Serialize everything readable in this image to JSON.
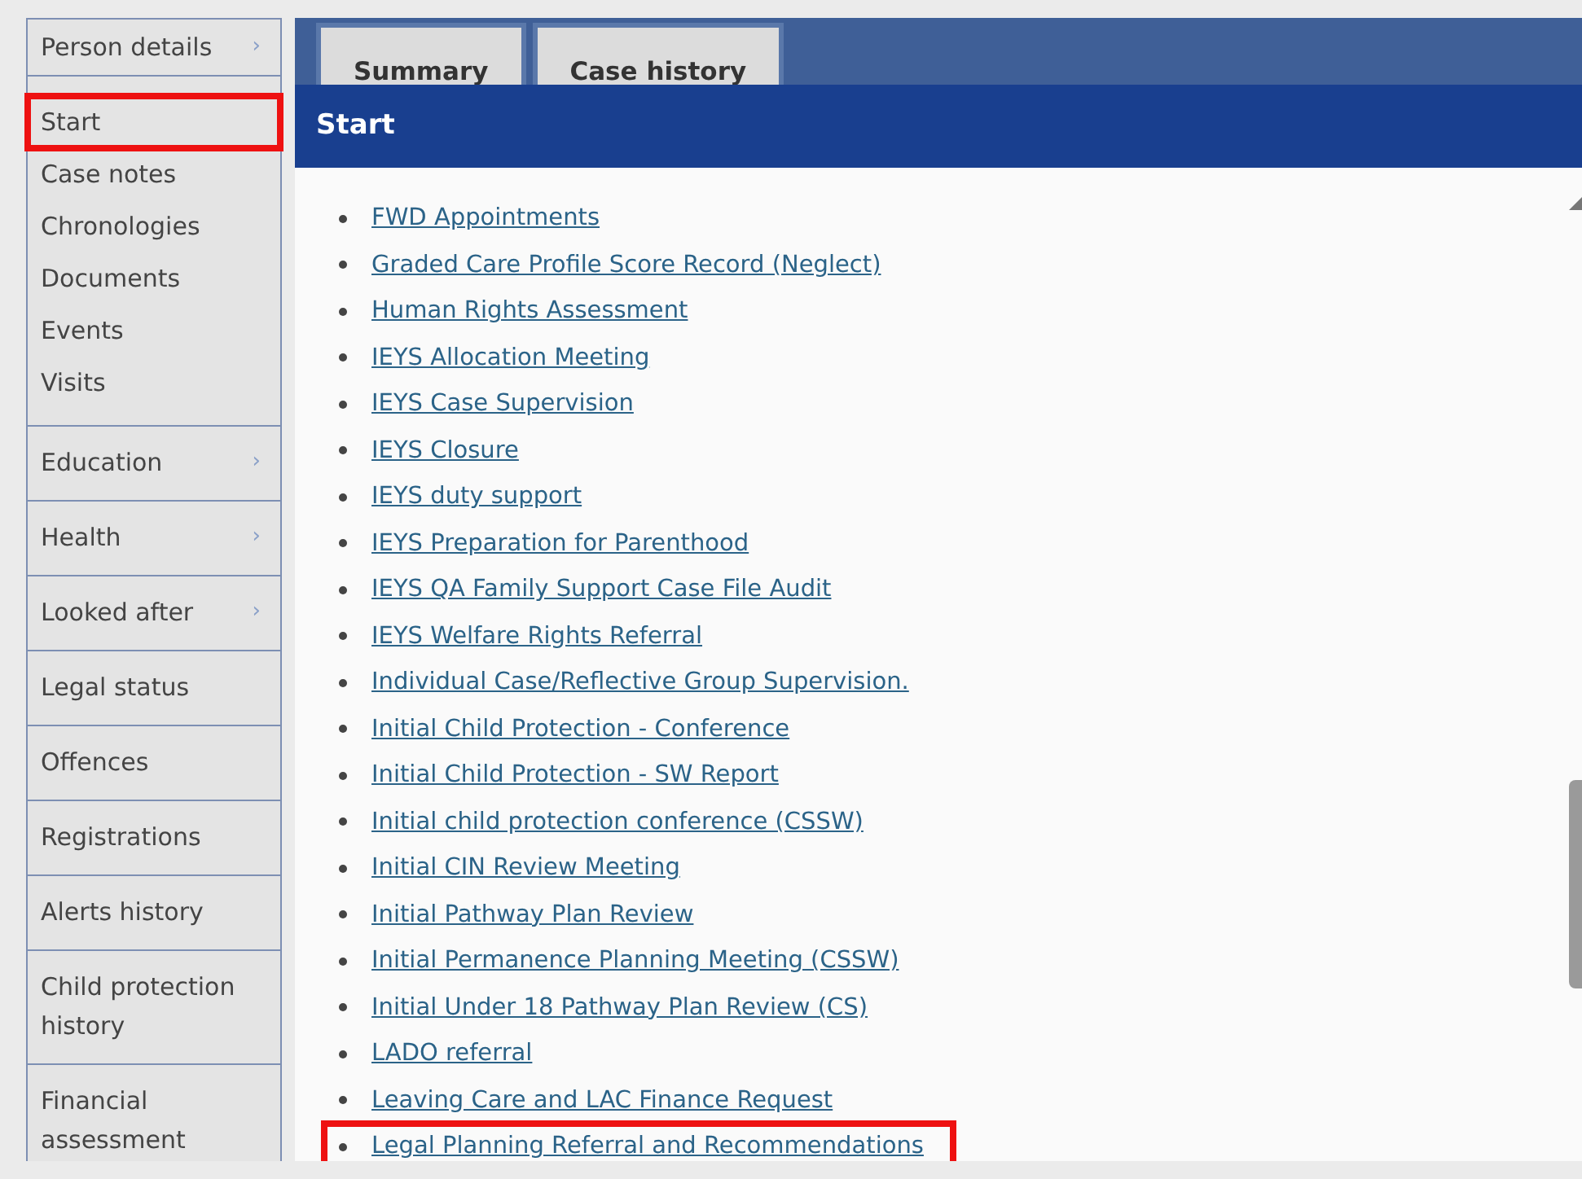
{
  "sidebar": {
    "header": {
      "label": "Person details",
      "chevron": "›"
    },
    "links": [
      {
        "label": "Start",
        "highlighted": true
      },
      {
        "label": "Case notes",
        "highlighted": false
      },
      {
        "label": "Chronologies",
        "highlighted": false
      },
      {
        "label": "Documents",
        "highlighted": false
      },
      {
        "label": "Events",
        "highlighted": false
      },
      {
        "label": "Visits",
        "highlighted": false
      }
    ],
    "sections": [
      {
        "label": "Education",
        "chevron": "›"
      },
      {
        "label": "Health",
        "chevron": "›"
      },
      {
        "label": "Looked after",
        "chevron": "›"
      },
      {
        "label": "Legal status"
      },
      {
        "label": "Offences"
      },
      {
        "label": "Registrations"
      },
      {
        "label": "Alerts history"
      },
      {
        "label": "Child protection history"
      },
      {
        "label": "Financial assessment"
      }
    ]
  },
  "tabs": [
    {
      "label": "Summary",
      "selected": false
    },
    {
      "label": "Case history",
      "selected": false
    }
  ],
  "panel": {
    "title": "Start",
    "items": [
      {
        "label": "FWD Appointments",
        "highlighted": false
      },
      {
        "label": "Graded Care Profile Score Record (Neglect)",
        "highlighted": false
      },
      {
        "label": "Human Rights Assessment",
        "highlighted": false
      },
      {
        "label": "IEYS Allocation Meeting",
        "highlighted": false
      },
      {
        "label": "IEYS Case Supervision",
        "highlighted": false
      },
      {
        "label": "IEYS Closure",
        "highlighted": false
      },
      {
        "label": "IEYS duty support",
        "highlighted": false
      },
      {
        "label": "IEYS Preparation for Parenthood",
        "highlighted": false
      },
      {
        "label": "IEYS QA Family Support Case File Audit",
        "highlighted": false
      },
      {
        "label": "IEYS Welfare Rights Referral",
        "highlighted": false
      },
      {
        "label": "Individual Case/Reflective Group Supervision.",
        "highlighted": false
      },
      {
        "label": "Initial Child Protection - Conference",
        "highlighted": false
      },
      {
        "label": "Initial Child Protection - SW Report",
        "highlighted": false
      },
      {
        "label": "Initial child protection conference (CSSW)",
        "highlighted": false
      },
      {
        "label": "Initial CIN Review Meeting",
        "highlighted": false
      },
      {
        "label": "Initial Pathway Plan Review",
        "highlighted": false
      },
      {
        "label": "Initial Permanence Planning Meeting (CSSW)",
        "highlighted": false
      },
      {
        "label": "Initial Under 18 Pathway Plan Review (CS)",
        "highlighted": false
      },
      {
        "label": "LADO referral",
        "highlighted": false
      },
      {
        "label": "Leaving Care and LAC Finance Request",
        "highlighted": false
      },
      {
        "label": "Legal Planning Referral and Recommendations",
        "highlighted": true
      }
    ]
  }
}
